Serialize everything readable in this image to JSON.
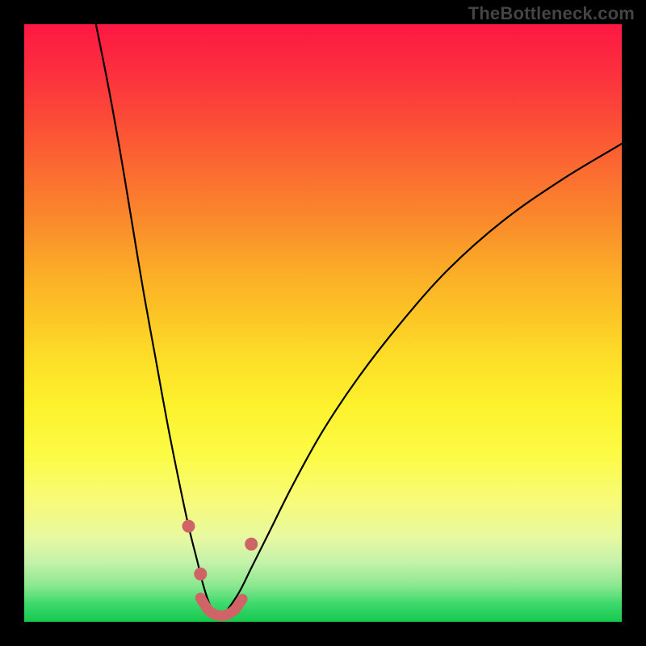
{
  "watermark": "TheBottleneck.com",
  "colors": {
    "background_frame": "#000000",
    "gradient_top": "#fd1842",
    "gradient_bottom": "#15c94f",
    "curve": "#000000",
    "marker": "#cf6366"
  },
  "chart_data": {
    "type": "line",
    "title": "",
    "xlabel": "",
    "ylabel": "",
    "xlim": [
      0,
      100
    ],
    "ylim": [
      0,
      100
    ],
    "notes": "Bottleneck-style curve. Two branches of a V shape; y≈100 means severe bottleneck (top, red), y≈0 means balanced (bottom, green). Minimum around x≈33.",
    "series": [
      {
        "name": "left-branch",
        "x": [
          12,
          14,
          16,
          18,
          20,
          22,
          24,
          26,
          27.5,
          29,
          30,
          31,
          32,
          33
        ],
        "y": [
          100,
          90,
          79,
          67,
          55,
          44,
          33,
          23,
          16,
          10,
          6,
          3,
          1.5,
          1
        ]
      },
      {
        "name": "right-branch",
        "x": [
          33,
          34,
          36,
          38,
          41,
          45,
          50,
          56,
          63,
          71,
          80,
          90,
          100
        ],
        "y": [
          1,
          2,
          5,
          9,
          15,
          23,
          32,
          41,
          50,
          59,
          67,
          74,
          80
        ]
      }
    ],
    "markers": [
      {
        "name": "left-dot-upper",
        "x": 27.5,
        "y": 16
      },
      {
        "name": "left-dot-lower",
        "x": 29.5,
        "y": 8
      },
      {
        "name": "right-dot",
        "x": 38,
        "y": 13
      }
    ],
    "highlight_segment": {
      "name": "valley-bridge",
      "x": [
        29.5,
        31,
        33,
        35,
        36.5
      ],
      "y": [
        4,
        1.8,
        1,
        1.8,
        3.8
      ]
    }
  }
}
